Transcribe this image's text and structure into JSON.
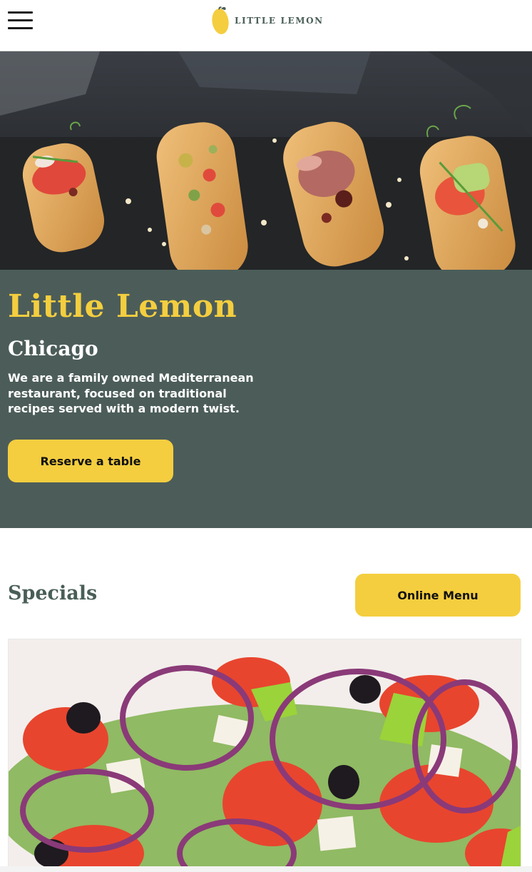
{
  "header": {
    "menu_icon": "hamburger-menu-icon",
    "logo_icon": "lemon-icon",
    "logo_text": "LITTLE LEMON"
  },
  "hero_image": {
    "subject": "bruschetta-photo"
  },
  "hero": {
    "title": "Little Lemon",
    "city": "Chicago",
    "description": "We are a family owned Mediterranean restaurant, focused on traditional recipes served with a modern twist.",
    "reserve_label": "Reserve a table"
  },
  "specials": {
    "title": "Specials",
    "online_menu_label": "Online Menu",
    "card_image": "greek-salad-photo"
  },
  "colors": {
    "primary_green": "#495e57",
    "primary_yellow": "#f4ce3f",
    "hero_bg": "#4c5d59",
    "white": "#ffffff"
  }
}
